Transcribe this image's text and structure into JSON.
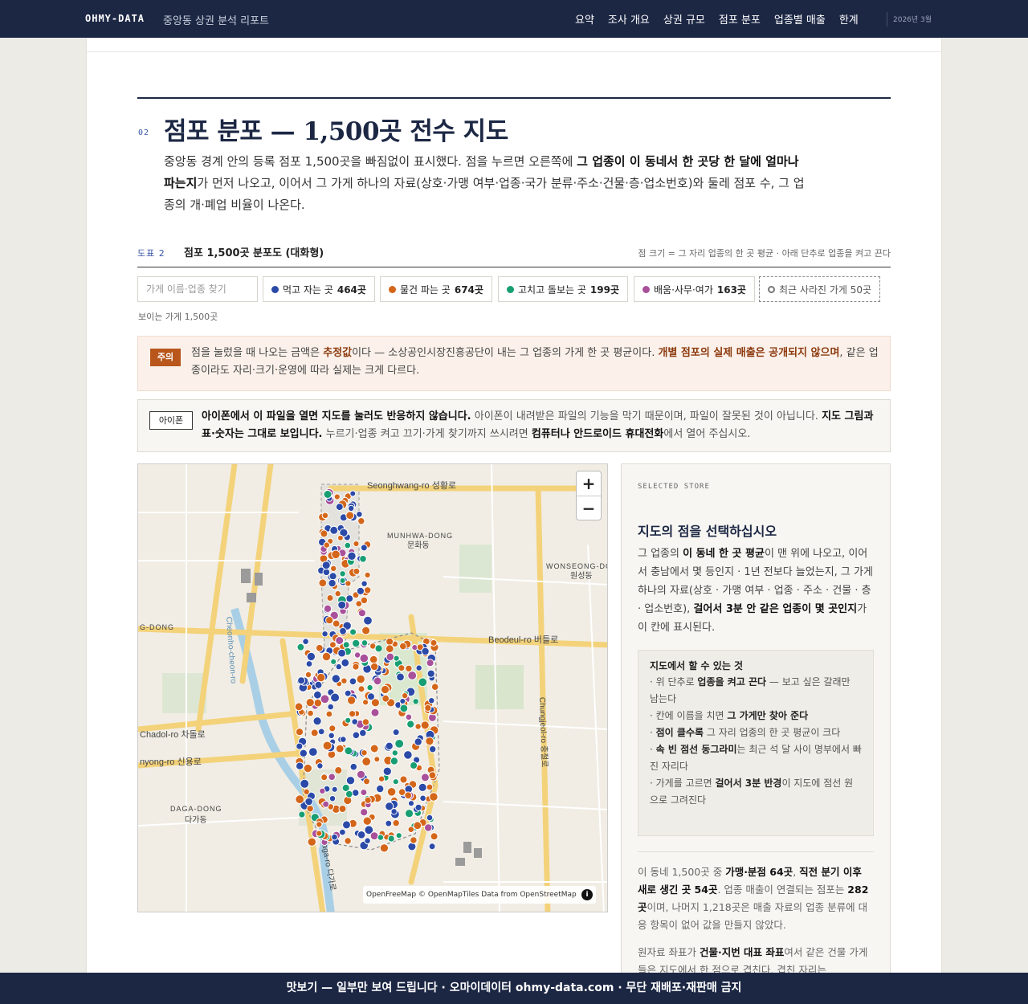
{
  "header": {
    "brand": "OHMY-DATA",
    "report_title": "중앙동 상권 분석 리포트",
    "nav": [
      "요약",
      "조사 개요",
      "상권 규모",
      "점포 분포",
      "업종별 매출",
      "한계"
    ],
    "date": "2026년 3월"
  },
  "section": {
    "number": "02",
    "title": "점포 분포 — 1,500곳 전수 지도",
    "desc_1": "중앙동 경계 안의 등록 점포 1,500곳을 빠짐없이 표시했다. 점을 누르면 오른쪽에 ",
    "desc_bold": "그 업종이 이 동네서 한 곳당 한 달에 얼마나 파는지",
    "desc_2": "가 먼저 나오고, 이어서 그 가게 하나의 자료(상호·가맹 여부·업종·국가 분류·주소·건물·층·업소번호)와 둘레 점포 수, 그 업종의 개·폐업 비율이 나온다."
  },
  "figure": {
    "number": "도표 2",
    "title": "점포 1,500곳 분포도 (대화형)",
    "note": "점 크기 = 그 자리 업종의 한 곳 평균 · 아래 단추로 업종을 켜고 끈다"
  },
  "filters": {
    "search_placeholder": "가게 이름·업종 찾기",
    "chips": [
      {
        "label": "먹고 자는 곳",
        "count": "464곳",
        "color": "#2b4aa8"
      },
      {
        "label": "물건 파는 곳",
        "count": "674곳",
        "color": "#d4661a"
      },
      {
        "label": "고치고 돌보는 곳",
        "count": "199곳",
        "color": "#179e72"
      },
      {
        "label": "배움·사무·여가",
        "count": "163곳",
        "color": "#a8509a"
      }
    ],
    "closed_chip": "최근 사라진 가게 50곳",
    "visible_count": "보이는 가게 1,500곳"
  },
  "caution": {
    "tag": "주의",
    "text_1": "점을 눌렀을 때 나오는 금액은 ",
    "bold_1": "추정값",
    "text_2": "이다 — 소상공인시장진흥공단이 내는 그 업종의 가게 한 곳 평균이다. ",
    "bold_2": "개별 점포의 실제 매출은 공개되지 않으며",
    "text_3": ", 같은 업종이라도 자리·크기·운영에 따라 실제는 크게 다르다."
  },
  "iphone": {
    "tag": "아이폰",
    "bold_1": "아이폰에서 이 파일을 열면 지도를 눌러도 반응하지 않습니다.",
    "text_1": " 아이폰이 내려받은 파일의 기능을 막기 때문이며, 파일이 잘못된 것이 아닙니다. ",
    "bold_2": "지도 그림과 표·숫자는 그대로 보입니다.",
    "text_2": " 누르기·업종 켜고 끄기·가게 찾기까지 쓰시려면 ",
    "bold_3": "컴퓨터나 안드로이드 휴대전화",
    "text_3": "에서 열어 주십시오."
  },
  "map": {
    "attribution": "OpenFreeMap © OpenMapTiles Data from OpenStreetMap",
    "zoom_in": "+",
    "zoom_out": "−",
    "labels": [
      "Seonghwang-ro 성황로",
      "MUNHWA-DONG",
      "문화동",
      "WONSEONG-DO",
      "원성동",
      "Beodeul-ro 버들로",
      "Chungjeol-ro 충절로",
      "Chadol-ro 차돌로",
      "nyong-ro 신용로",
      "DAGA-DONG",
      "다가동",
      "Daga-ro 다가로",
      "G-DONG",
      "Cheonho-cheon-ro"
    ]
  },
  "side": {
    "kicker": "SELECTED STORE",
    "title": "지도의 점을 선택하십시오",
    "desc_1": "그 업종의 ",
    "desc_b1": "이 동네 한 곳 평균",
    "desc_2": "이 맨 위에 나오고, 이어서 충남에서 몇 등인지 · 1년 전보다 늘었는지, 그 가게 하나의 자료(상호 · 가맹 여부 · 업종 · 주소 · 건물 · 층 · 업소번호), ",
    "desc_b2": "걸어서 3분 안 같은 업종이 몇 곳인지",
    "desc_3": "가 이 칸에 표시된다.",
    "todo_title": "지도에서 할 수 있는 것",
    "todo": [
      {
        "pre": "· 위 단추로 ",
        "b": "업종을 켜고 끈다",
        "post": " — 보고 싶은 갈래만 남는다"
      },
      {
        "pre": "· 칸에 이름을 치면 ",
        "b": "그 가게만 찾아 준다",
        "post": ""
      },
      {
        "pre": "· ",
        "b": "점이 클수록",
        "post": " 그 자리 업종의 한 곳 평균이 크다"
      },
      {
        "pre": "· ",
        "b": "속 빈 점선 동그라미",
        "post": "는 최근 석 달 사이 명부에서 빠진 자리다"
      },
      {
        "pre": "· 가게를 고르면 ",
        "b": "걸어서 3분 반경",
        "post": "이 지도에 점선 원으로 그려진다"
      }
    ],
    "p1_1": "이 동네 1,500곳 중 ",
    "p1_b1": "가맹·분점 64곳",
    "p1_2": ", ",
    "p1_b2": "직전 분기 이후 새로 생긴 곳 54곳",
    "p1_3": ". 업종 매출이 연결되는 점포는 ",
    "p1_b3": "282곳",
    "p1_4": "이며, 나머지 1,218곳은 매출 자료의 업종 분류에 대응 항목이 없어 값을 만들지 않았다.",
    "p2_1": "원자료 좌표가 ",
    "p2_b1": "건물·지번 대표 좌표",
    "p2_2": "여서 같은 건물 가게들은 지도에서 한 점으로 겹친다. 겹친 자리는"
  },
  "footer": {
    "text": "맛보기 — 일부만 보여 드립니다 · 오마이데이터 ohmy-data.com · 무단 재배포·재판매 금지"
  }
}
